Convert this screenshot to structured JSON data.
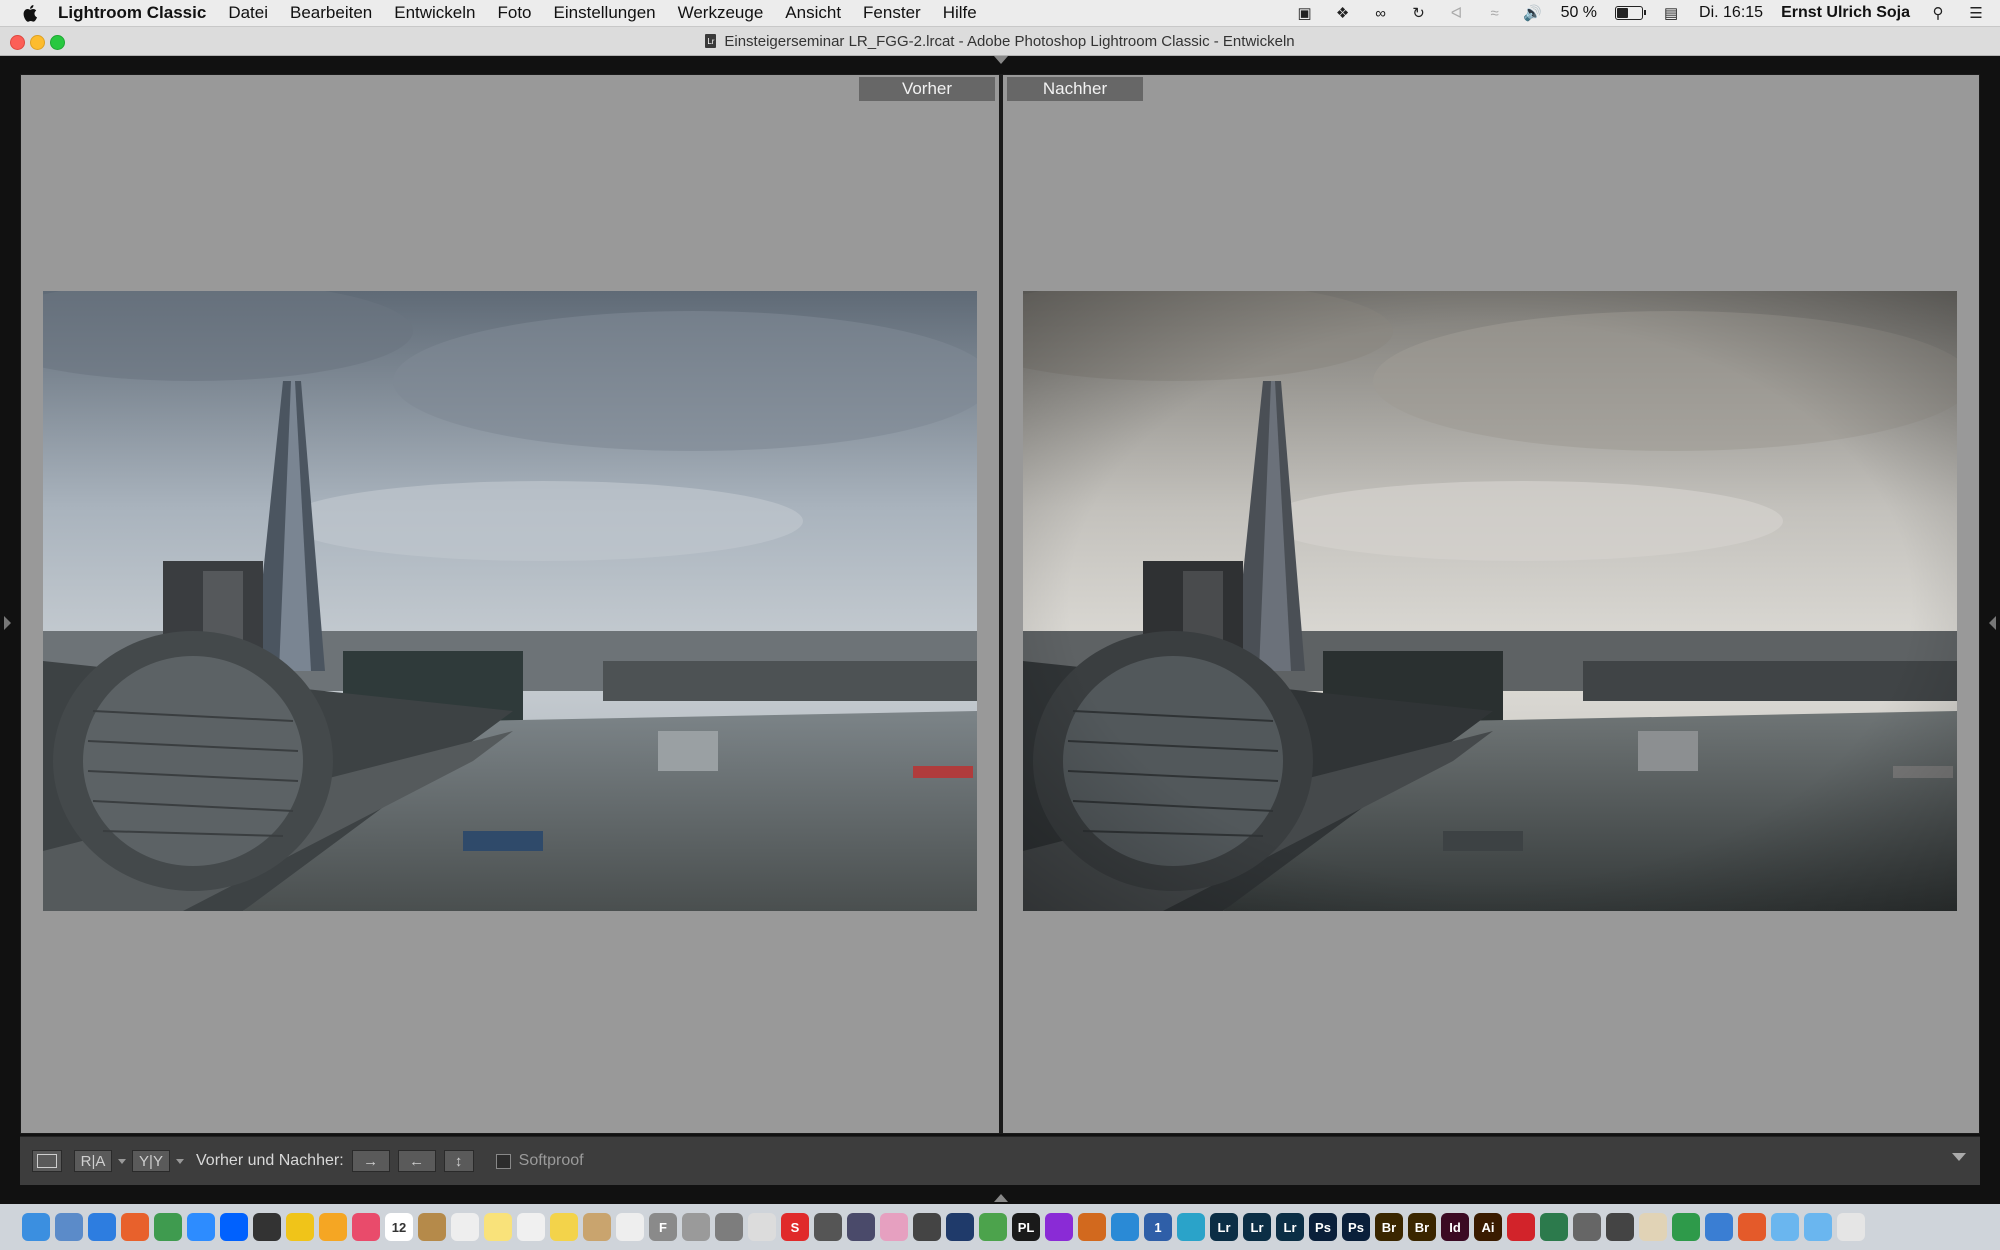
{
  "menubar": {
    "app_name": "Lightroom Classic",
    "items": [
      "Datei",
      "Bearbeiten",
      "Entwickeln",
      "Foto",
      "Einstellungen",
      "Werkzeuge",
      "Ansicht",
      "Fenster",
      "Hilfe"
    ],
    "battery_percent": "50 %",
    "battery_level": 0.5,
    "clock": "Di. 16:15",
    "user": "Ernst Ulrich Soja"
  },
  "window": {
    "doc_icon_label": "Lr",
    "title": "Einsteigerseminar LR_FGG-2.lrcat - Adobe Photoshop Lightroom Classic - Entwickeln"
  },
  "compare": {
    "before_label": "Vorher",
    "after_label": "Nachher"
  },
  "toolbar": {
    "compare_label": "Vorher und Nachher:",
    "softproof_label": "Softproof",
    "view_ra_label": "R|A",
    "view_yy_label": "Y|Y"
  },
  "dock": {
    "icons": [
      {
        "name": "finder-icon",
        "label": "",
        "color": "#3b8fe0"
      },
      {
        "name": "preview-icon",
        "label": "",
        "color": "#5b8bc9"
      },
      {
        "name": "safari-icon",
        "label": "",
        "color": "#2d7de0"
      },
      {
        "name": "firefox-icon",
        "label": "",
        "color": "#e8612c"
      },
      {
        "name": "chrome-icon",
        "label": "",
        "color": "#3f9b4f"
      },
      {
        "name": "zoom-icon",
        "label": "",
        "color": "#2d8cff"
      },
      {
        "name": "dropbox-icon",
        "label": "",
        "color": "#0061fe"
      },
      {
        "name": "github-icon",
        "label": "",
        "color": "#333333"
      },
      {
        "name": "cyberduck-icon",
        "label": "",
        "color": "#f0c419"
      },
      {
        "name": "transmit-icon",
        "label": "",
        "color": "#f5a623"
      },
      {
        "name": "itunes-icon",
        "label": "",
        "color": "#e94b6b"
      },
      {
        "name": "calendar-icon",
        "label": "12",
        "color": "#ffffff"
      },
      {
        "name": "notebook-icon",
        "label": "",
        "color": "#b58a4a"
      },
      {
        "name": "textedit-icon",
        "label": "",
        "color": "#eeeeee"
      },
      {
        "name": "notes-icon",
        "label": "",
        "color": "#f9e27a"
      },
      {
        "name": "pages-icon",
        "label": "",
        "color": "#f0f0f0"
      },
      {
        "name": "stickies-icon",
        "label": "",
        "color": "#f3d34a"
      },
      {
        "name": "contacts-icon",
        "label": "",
        "color": "#c9a46e"
      },
      {
        "name": "voicememo-icon",
        "label": "",
        "color": "#eeeeee"
      },
      {
        "name": "font-book-icon",
        "label": "F",
        "color": "#8a8a8a"
      },
      {
        "name": "scissors-icon",
        "label": "",
        "color": "#9a9a9a"
      },
      {
        "name": "scanner-icon",
        "label": "",
        "color": "#7d7d7d"
      },
      {
        "name": "script-editor-icon",
        "label": "",
        "color": "#dcdcdc"
      },
      {
        "name": "sketchbook-icon",
        "label": "S",
        "color": "#e02a2a"
      },
      {
        "name": "camera-icon",
        "label": "",
        "color": "#555555"
      },
      {
        "name": "affinity-photo-icon",
        "label": "",
        "color": "#4a4a6a"
      },
      {
        "name": "color-picker-icon",
        "label": "",
        "color": "#e6a0c0"
      },
      {
        "name": "aperture-icon",
        "label": "",
        "color": "#444444"
      },
      {
        "name": "cube-icon",
        "label": "",
        "color": "#1f3a6a"
      },
      {
        "name": "frog-icon",
        "label": "",
        "color": "#4ca34c"
      },
      {
        "name": "dxo-icon",
        "label": "PL",
        "color": "#1a1a1a"
      },
      {
        "name": "affinity-designer-icon",
        "label": "",
        "color": "#8a2bd6"
      },
      {
        "name": "pattern-icon",
        "label": "",
        "color": "#d2691e"
      },
      {
        "name": "affinity-icon",
        "label": "",
        "color": "#2a8ad6"
      },
      {
        "name": "1password-icon",
        "label": "1",
        "color": "#2f5fa8"
      },
      {
        "name": "system-prefs-icon",
        "label": "",
        "color": "#2aa3c9"
      },
      {
        "name": "lightroom-icon-1",
        "label": "Lr",
        "color": "#0b2e45"
      },
      {
        "name": "lightroom-icon-2",
        "label": "Lr",
        "color": "#0b2e45"
      },
      {
        "name": "lightroom-icon-3",
        "label": "Lr",
        "color": "#0b2e45"
      },
      {
        "name": "photoshop-icon-1",
        "label": "Ps",
        "color": "#0a1f3a"
      },
      {
        "name": "photoshop-icon-2",
        "label": "Ps",
        "color": "#0a1f3a"
      },
      {
        "name": "bridge-icon-1",
        "label": "Br",
        "color": "#3a2600"
      },
      {
        "name": "bridge-icon-2",
        "label": "Br",
        "color": "#3a2600"
      },
      {
        "name": "indesign-icon",
        "label": "Id",
        "color": "#3b0a23"
      },
      {
        "name": "illustrator-icon",
        "label": "Ai",
        "color": "#3a1b00"
      },
      {
        "name": "acrobat-icon",
        "label": "",
        "color": "#d2232a"
      },
      {
        "name": "evernote-icon",
        "label": "",
        "color": "#2c7a4c"
      },
      {
        "name": "codesign-icon",
        "label": "",
        "color": "#666666"
      },
      {
        "name": "ripper-icon",
        "label": "",
        "color": "#444444"
      },
      {
        "name": "dictionary-icon",
        "label": "",
        "color": "#e1d3b6"
      },
      {
        "name": "numbers-icon",
        "label": "",
        "color": "#2e9a4a"
      },
      {
        "name": "keynote-icon",
        "label": "",
        "color": "#3a7ed3"
      },
      {
        "name": "sketchup-icon",
        "label": "",
        "color": "#e45a2a"
      },
      {
        "name": "folder-icon-1",
        "label": "",
        "color": "#6ab6ef"
      },
      {
        "name": "folder-icon-2",
        "label": "",
        "color": "#6ab6ef"
      },
      {
        "name": "trash-icon",
        "label": "",
        "color": "#e5e5e5"
      }
    ]
  }
}
